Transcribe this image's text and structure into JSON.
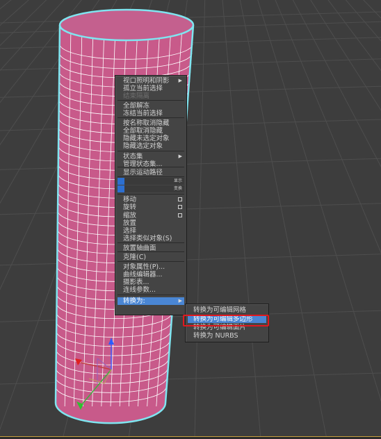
{
  "quad_menu": {
    "items": [
      {
        "label": "视口照明和阴影",
        "arrow": true
      },
      {
        "label": "孤立当前选择"
      },
      {
        "label": "结束隔离",
        "disabled": true
      },
      {
        "label": "全部解冻"
      },
      {
        "label": "冻结当前选择"
      },
      {
        "label": "按名称取消隐藏"
      },
      {
        "label": "全部取消隐藏"
      },
      {
        "label": "隐藏未选定对象"
      },
      {
        "label": "隐藏选定对象"
      },
      {
        "label": "状态集",
        "arrow": true
      },
      {
        "label": "管理状态集..."
      },
      {
        "label": "显示运动路径"
      },
      {
        "slider_label": "显示"
      },
      {
        "slider_label": "变换"
      },
      {
        "label": "移动",
        "box": true
      },
      {
        "label": "旋转",
        "box": true
      },
      {
        "label": "缩放",
        "box": true
      },
      {
        "label": "放置"
      },
      {
        "label": "选择"
      },
      {
        "label": "选择类似对象(S)"
      },
      {
        "label": "放置轴曲面"
      },
      {
        "label": "克隆(C)"
      },
      {
        "label": "对象属性(P)..."
      },
      {
        "label": "曲线编辑器..."
      },
      {
        "label": "摄影表..."
      },
      {
        "label": "连线参数..."
      },
      {
        "label": "转换为:",
        "arrow": true
      }
    ]
  },
  "submenu": {
    "items": [
      {
        "label": "转换为可编辑网格"
      },
      {
        "label": "转换为可编辑多边形"
      },
      {
        "label": "转换为可编辑面片"
      },
      {
        "label": "转换为 NURBS"
      }
    ]
  },
  "colors": {
    "viewport_bg": "#3d3d3d",
    "grid_line": "#4e4e4e",
    "object_fill": "#c85a8a",
    "object_wire": "#ffffff",
    "selection_outline": "#7fe5f0",
    "highlight": "#4a86d4",
    "annotation": "#e0191f"
  }
}
